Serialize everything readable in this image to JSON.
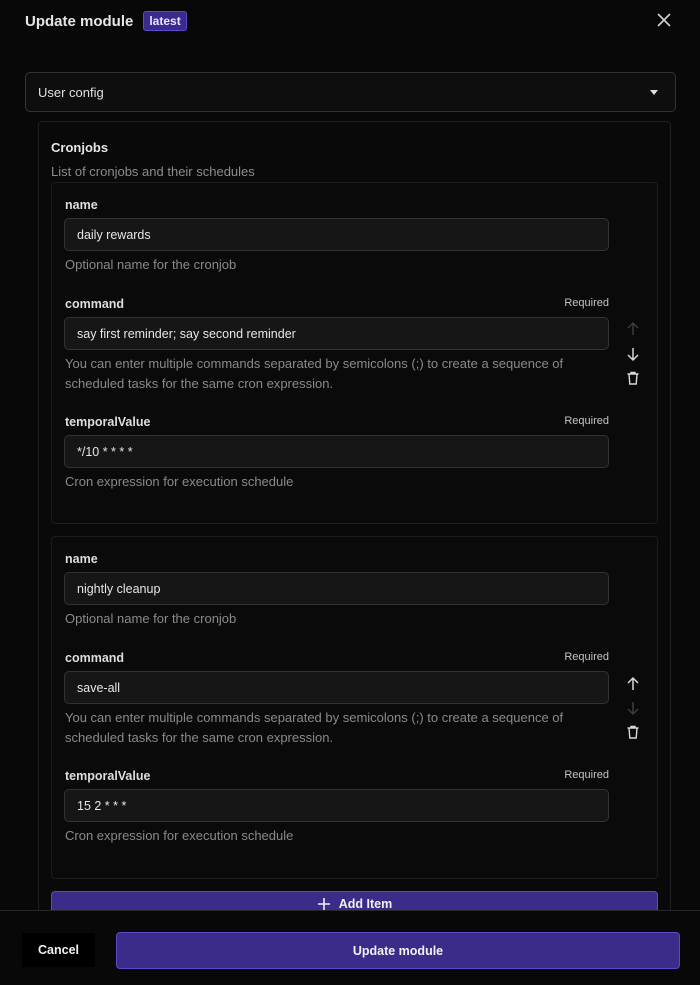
{
  "header": {
    "title": "Update module",
    "badge": "latest"
  },
  "config_select": {
    "value": "User config"
  },
  "group": {
    "title": "Cronjobs",
    "description": "List of cronjobs and their schedules"
  },
  "field_meta": {
    "name_label": "name",
    "name_help": "Optional name for the cronjob",
    "command_label": "command",
    "command_help": "You can enter multiple commands separated by semicolons (;) to create a sequence of scheduled tasks for the same cron expression.",
    "temporal_label": "temporalValue",
    "temporal_help": "Cron expression for execution schedule",
    "required": "Required"
  },
  "items": [
    {
      "name": "daily rewards",
      "command": "say first reminder; say second reminder",
      "temporalValue": "*/10 * * * *"
    },
    {
      "name": "nightly cleanup",
      "command": "save-all",
      "temporalValue": "15 2 * * *"
    }
  ],
  "add_item_label": "Add Item",
  "footer": {
    "cancel": "Cancel",
    "update": "Update module"
  },
  "colors": {
    "accent": "#3a2c88",
    "accent_border": "#5b49c9",
    "background": "#080808"
  }
}
